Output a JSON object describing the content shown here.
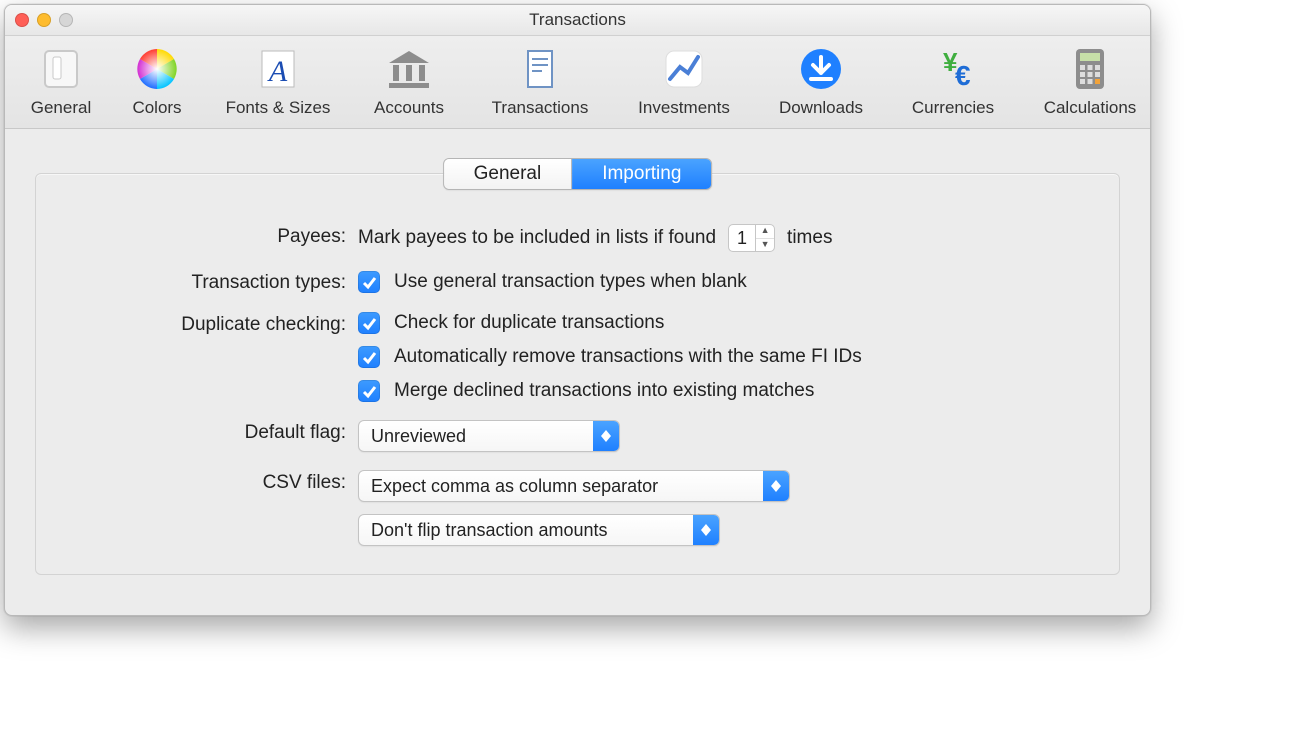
{
  "window": {
    "title": "Transactions"
  },
  "toolbar": {
    "items": [
      {
        "label": "General"
      },
      {
        "label": "Colors"
      },
      {
        "label": "Fonts & Sizes"
      },
      {
        "label": "Accounts"
      },
      {
        "label": "Transactions"
      },
      {
        "label": "Investments"
      },
      {
        "label": "Downloads"
      },
      {
        "label": "Currencies"
      },
      {
        "label": "Calculations"
      }
    ]
  },
  "tabs": {
    "general": "General",
    "importing": "Importing"
  },
  "form": {
    "payees": {
      "label": "Payees:",
      "prefix": "Mark payees to be included in lists if found",
      "value": "1",
      "suffix": "times"
    },
    "txtypes": {
      "label": "Transaction types:",
      "option": "Use general transaction types when blank"
    },
    "dup": {
      "label": "Duplicate checking:",
      "opt1": "Check for duplicate transactions",
      "opt2": "Automatically remove transactions with the same FI IDs",
      "opt3": "Merge declined transactions into existing matches"
    },
    "flag": {
      "label": "Default flag:",
      "value": "Unreviewed"
    },
    "csv": {
      "label": "CSV files:",
      "sep": "Expect comma as column separator",
      "flip": "Don't flip transaction amounts"
    }
  }
}
